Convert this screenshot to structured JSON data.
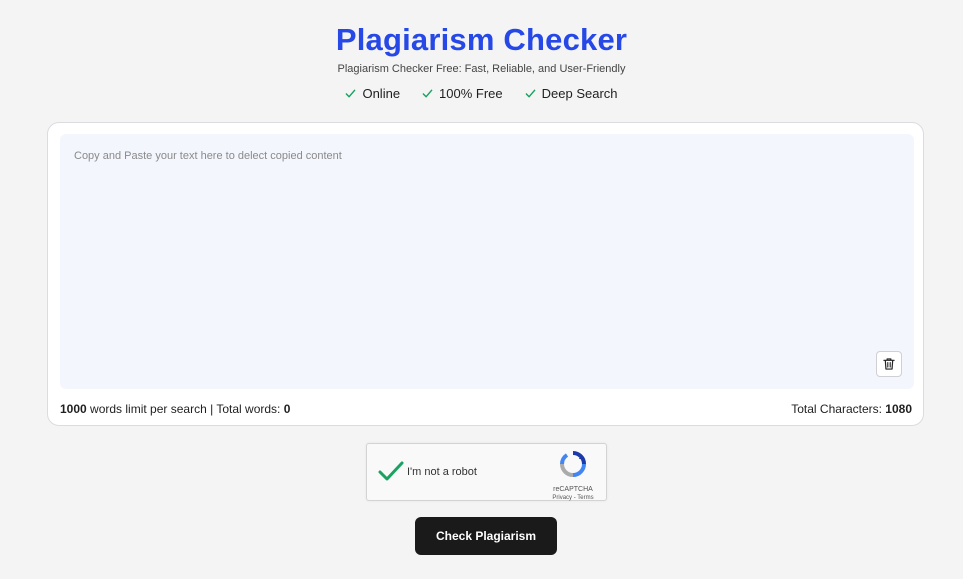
{
  "header": {
    "title": "Plagiarism Checker",
    "subtitle": "Plagiarism Checker Free: Fast, Reliable, and User-Friendly",
    "features": [
      "Online",
      "100% Free",
      "Deep Search"
    ]
  },
  "editor": {
    "placeholder": "Copy and Paste your text here to delect copied content",
    "value": ""
  },
  "counters": {
    "word_limit": "1000",
    "word_limit_label": "words limit per search",
    "separator": "|",
    "total_words_label": "Total words:",
    "total_words": "0",
    "total_characters_label": "Total Characters:",
    "total_characters": "1080"
  },
  "captcha": {
    "label": "I'm not a robot",
    "brand": "reCAPTCHA",
    "links": "Privacy - Terms",
    "checked": true
  },
  "actions": {
    "check_label": "Check Plagiarism"
  },
  "colors": {
    "accent": "#2548e6",
    "check": "#1aa260",
    "button_bg": "#1a1a1a"
  }
}
